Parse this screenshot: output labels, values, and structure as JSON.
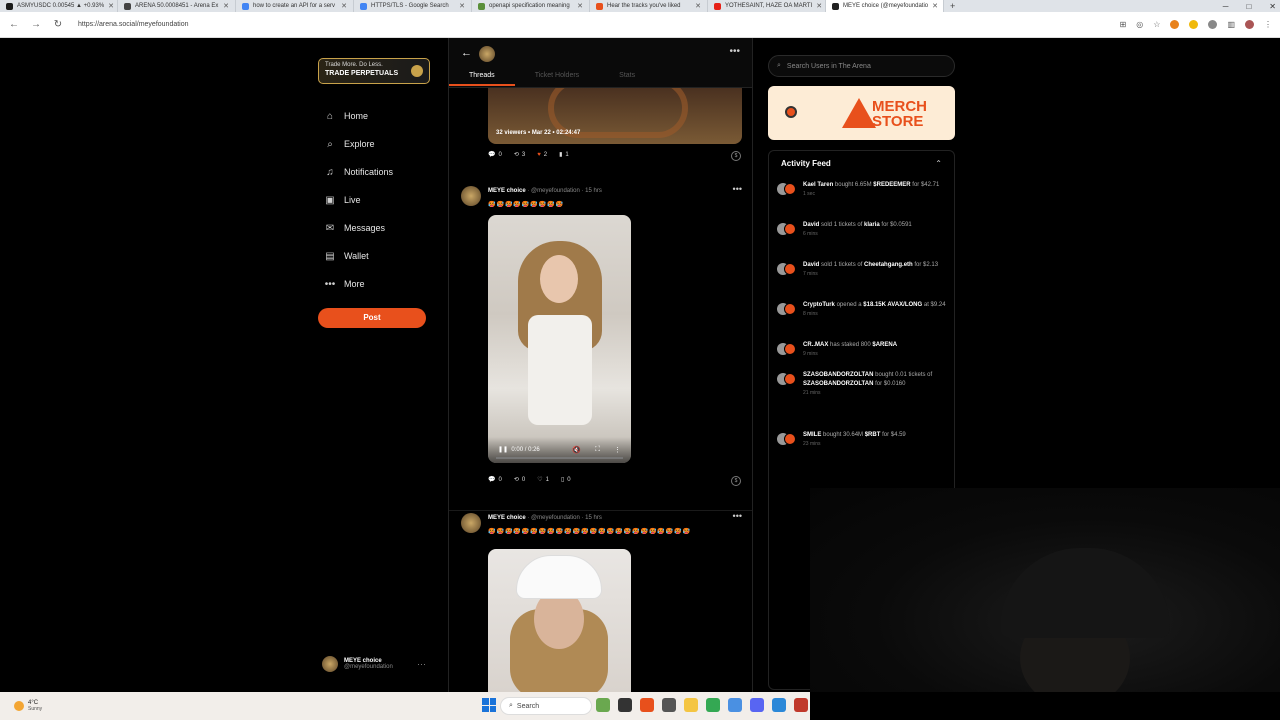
{
  "browser": {
    "tabs": [
      {
        "title": "ASMYUSDC 0.00545 ▲ +0.93%",
        "color": "#1b1b1b"
      },
      {
        "title": "ARENA 50.0008451 - Arena Ex",
        "color": "#444"
      },
      {
        "title": "how to create an API for a serv",
        "color": "#4285f4"
      },
      {
        "title": "HTTPS/TLS - Google Search",
        "color": "#4285f4"
      },
      {
        "title": "openapi specification meaning",
        "color": "#5a8f3a"
      },
      {
        "title": "Hear the tracks you've liked",
        "color": "#e8501c"
      },
      {
        "title": "YOTHESAINT, HAZE OA MARTI",
        "color": "#e62117"
      },
      {
        "title": "MEYE choice (@meyefoundatio",
        "color": "#222"
      }
    ],
    "url": "https://arena.social/meyefoundation"
  },
  "sidebar": {
    "promo_line1": "Trade More. Do Less.",
    "promo_line2": "TRADE PERPETUALS",
    "nav": [
      {
        "label": "Home",
        "icon": "⌂"
      },
      {
        "label": "Explore",
        "icon": "⌕"
      },
      {
        "label": "Notifications",
        "icon": "♫"
      },
      {
        "label": "Live",
        "icon": "▣"
      },
      {
        "label": "Messages",
        "icon": "✉"
      },
      {
        "label": "Wallet",
        "icon": "▤"
      },
      {
        "label": "More",
        "icon": "•••"
      }
    ],
    "post_label": "Post",
    "me_name": "MEYE choice",
    "me_handle": "@meyefoundation"
  },
  "feed": {
    "tabs": [
      "Threads",
      "Ticket Holders",
      "Stats"
    ],
    "live": {
      "viewers": "32 viewers",
      "date": "Mar 22",
      "duration": "02:24:47",
      "comments": "0",
      "reposts": "3",
      "likes": "2",
      "bookmarks": "1"
    },
    "posts": [
      {
        "name": "MEYE choice",
        "handle": "@meyefoundation",
        "time": "15 hrs",
        "emojis": "🥵🥵🥵🥵🥵🥵🥵🥵🥵",
        "video_time": "0:00 / 0:26",
        "comments": "0",
        "reposts": "0",
        "likes": "1",
        "bookmarks": "0"
      },
      {
        "name": "MEYE choice",
        "handle": "@meyefoundation",
        "time": "15 hrs",
        "emojis": "🥵🥵🥵🥵🥵🥵🥵🥵🥵🥵🥵🥵🥵🥵🥵🥵🥵🥵🥵🥵🥵🥵🥵🥵"
      }
    ]
  },
  "right": {
    "search_placeholder": "Search Users in The Arena",
    "merch_line1": "MERCH",
    "merch_line2": "STORE",
    "activity_title": "Activity Feed",
    "activity": [
      {
        "user": "Kael Taren",
        "action": "bought 6.65M",
        "target": "$REDEEMER",
        "rest": "for $42.71",
        "time": "1 sec"
      },
      {
        "user": "David",
        "action": "sold 1 tickets of",
        "target": "klaria",
        "rest": "for $0.0591",
        "time": "6 mins"
      },
      {
        "user": "David",
        "action": "sold 1 tickets of",
        "target": "Cheetahgang.eth",
        "rest": "for $2.13",
        "time": "7 mins"
      },
      {
        "user": "CryptoTurk",
        "action": "opened a",
        "target": "$18.15K AVAX/LONG",
        "rest": "at $9.24",
        "time": "8 mins"
      },
      {
        "user": "CR..MAX",
        "action": "has staked 800",
        "target": "$ARENA",
        "rest": "",
        "time": "9 mins"
      },
      {
        "user": "SZASOBANDORZOLTAN",
        "action": "bought 0.01 tickets of",
        "target": "SZASOBANDORZOLTAN",
        "rest": "for $0.0160",
        "time": "21 mins"
      },
      {
        "user": "SMILE",
        "action": "bought 30.64M",
        "target": "$RBT",
        "rest": "for $4.59",
        "time": "23 mins"
      }
    ]
  },
  "taskbar": {
    "temp": "4°C",
    "weather": "Sunny",
    "search": "Search"
  }
}
